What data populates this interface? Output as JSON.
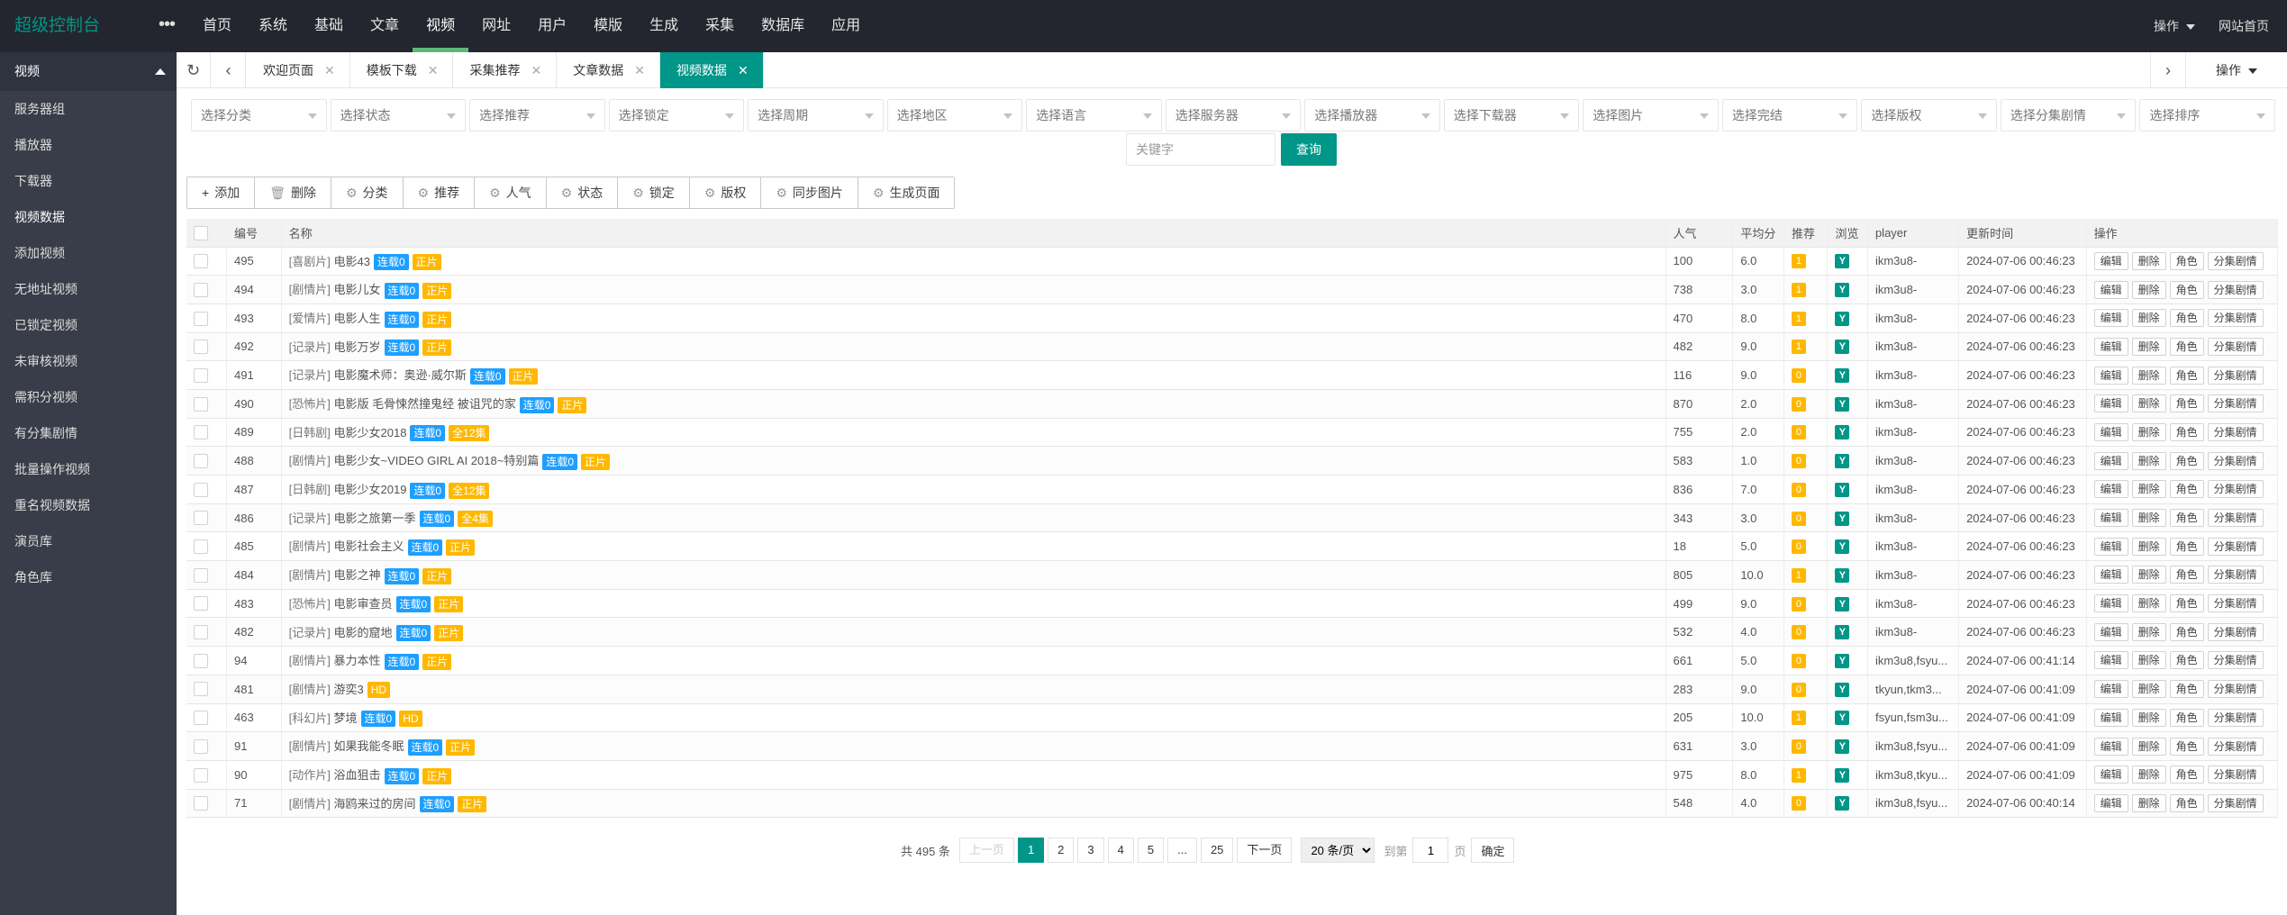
{
  "header": {
    "logo": "超级控制台",
    "nav": [
      "首页",
      "系统",
      "基础",
      "文章",
      "视频",
      "网址",
      "用户",
      "模版",
      "生成",
      "采集",
      "数据库",
      "应用"
    ],
    "active_nav": "视频",
    "ops": "操作",
    "site_home": "网站首页"
  },
  "sidebar": {
    "section": "视频",
    "items": [
      "服务器组",
      "播放器",
      "下载器",
      "视频数据",
      "添加视频",
      "无地址视频",
      "已锁定视频",
      "未审核视频",
      "需积分视频",
      "有分集剧情",
      "批量操作视频",
      "重名视频数据",
      "演员库",
      "角色库"
    ],
    "active": "视频数据"
  },
  "tabs": {
    "items": [
      "欢迎页面",
      "模板下载",
      "采集推荐",
      "文章数据",
      "视频数据"
    ],
    "active": "视频数据",
    "ops": "操作"
  },
  "filters": {
    "selects": [
      "选择分类",
      "选择状态",
      "选择推荐",
      "选择锁定",
      "选择周期",
      "选择地区",
      "选择语言",
      "选择服务器",
      "选择播放器",
      "选择下载器",
      "选择图片",
      "选择完结",
      "选择版权",
      "选择分集剧情",
      "选择排序"
    ],
    "keyword_placeholder": "关键字",
    "query": "查询"
  },
  "actions": [
    "添加",
    "删除",
    "分类",
    "推荐",
    "人气",
    "状态",
    "锁定",
    "版权",
    "同步图片",
    "生成页面"
  ],
  "table": {
    "headers": [
      "编号",
      "名称",
      "人气",
      "平均分",
      "推荐",
      "浏览",
      "player",
      "更新时间",
      "操作"
    ],
    "row_ops": [
      "编辑",
      "删除",
      "角色",
      "分集剧情"
    ],
    "rows": [
      {
        "id": "495",
        "type": "[喜剧片]",
        "name": "电影43",
        "b1": "连载0",
        "b2": "正片",
        "hits": "100",
        "score": "6.0",
        "rec": "1",
        "view": "Y",
        "player": "ikm3u8-",
        "time": "2024-07-06 00:46:23"
      },
      {
        "id": "494",
        "type": "[剧情片]",
        "name": "电影儿女",
        "b1": "连载0",
        "b2": "正片",
        "hits": "738",
        "score": "3.0",
        "rec": "1",
        "view": "Y",
        "player": "ikm3u8-",
        "time": "2024-07-06 00:46:23"
      },
      {
        "id": "493",
        "type": "[爱情片]",
        "name": "电影人生",
        "b1": "连载0",
        "b2": "正片",
        "hits": "470",
        "score": "8.0",
        "rec": "1",
        "view": "Y",
        "player": "ikm3u8-",
        "time": "2024-07-06 00:46:23"
      },
      {
        "id": "492",
        "type": "[记录片]",
        "name": "电影万岁",
        "b1": "连载0",
        "b2": "正片",
        "hits": "482",
        "score": "9.0",
        "rec": "1",
        "view": "Y",
        "player": "ikm3u8-",
        "time": "2024-07-06 00:46:23"
      },
      {
        "id": "491",
        "type": "[记录片]",
        "name": "电影魔术师：奥逊·威尔斯",
        "b1": "连载0",
        "b2": "正片",
        "hits": "116",
        "score": "9.0",
        "rec": "0",
        "view": "Y",
        "player": "ikm3u8-",
        "time": "2024-07-06 00:46:23"
      },
      {
        "id": "490",
        "type": "[恐怖片]",
        "name": "电影版 毛骨悚然撞鬼经 被诅咒的家",
        "b1": "连载0",
        "b2": "正片",
        "hits": "870",
        "score": "2.0",
        "rec": "0",
        "view": "Y",
        "player": "ikm3u8-",
        "time": "2024-07-06 00:46:23"
      },
      {
        "id": "489",
        "type": "[日韩剧]",
        "name": "电影少女2018",
        "b1": "连载0",
        "b2": "全12集",
        "hits": "755",
        "score": "2.0",
        "rec": "0",
        "view": "Y",
        "player": "ikm3u8-",
        "time": "2024-07-06 00:46:23"
      },
      {
        "id": "488",
        "type": "[剧情片]",
        "name": "电影少女~VIDEO GIRL AI 2018~特别篇",
        "b1": "连载0",
        "b2": "正片",
        "hits": "583",
        "score": "1.0",
        "rec": "0",
        "view": "Y",
        "player": "ikm3u8-",
        "time": "2024-07-06 00:46:23"
      },
      {
        "id": "487",
        "type": "[日韩剧]",
        "name": "电影少女2019",
        "b1": "连载0",
        "b2": "全12集",
        "hits": "836",
        "score": "7.0",
        "rec": "0",
        "view": "Y",
        "player": "ikm3u8-",
        "time": "2024-07-06 00:46:23"
      },
      {
        "id": "486",
        "type": "[记录片]",
        "name": "电影之旅第一季",
        "b1": "连载0",
        "b2": "全4集",
        "hits": "343",
        "score": "3.0",
        "rec": "0",
        "view": "Y",
        "player": "ikm3u8-",
        "time": "2024-07-06 00:46:23"
      },
      {
        "id": "485",
        "type": "[剧情片]",
        "name": "电影社会主义",
        "b1": "连载0",
        "b2": "正片",
        "hits": "18",
        "score": "5.0",
        "rec": "0",
        "view": "Y",
        "player": "ikm3u8-",
        "time": "2024-07-06 00:46:23"
      },
      {
        "id": "484",
        "type": "[剧情片]",
        "name": "电影之神",
        "b1": "连载0",
        "b2": "正片",
        "hits": "805",
        "score": "10.0",
        "rec": "1",
        "view": "Y",
        "player": "ikm3u8-",
        "time": "2024-07-06 00:46:23"
      },
      {
        "id": "483",
        "type": "[恐怖片]",
        "name": "电影审查员",
        "b1": "连载0",
        "b2": "正片",
        "hits": "499",
        "score": "9.0",
        "rec": "0",
        "view": "Y",
        "player": "ikm3u8-",
        "time": "2024-07-06 00:46:23"
      },
      {
        "id": "482",
        "type": "[记录片]",
        "name": "电影的窟地",
        "b1": "连载0",
        "b2": "正片",
        "hits": "532",
        "score": "4.0",
        "rec": "0",
        "view": "Y",
        "player": "ikm3u8-",
        "time": "2024-07-06 00:46:23"
      },
      {
        "id": "94",
        "type": "[剧情片]",
        "name": "暴力本性",
        "b1": "连载0",
        "b2": "正片",
        "hits": "661",
        "score": "5.0",
        "rec": "0",
        "view": "Y",
        "player": "ikm3u8,fsyu...",
        "time": "2024-07-06 00:41:14"
      },
      {
        "id": "481",
        "type": "[剧情片]",
        "name": "游奕3",
        "b1": "",
        "b2": "HD",
        "hits": "283",
        "score": "9.0",
        "rec": "0",
        "view": "Y",
        "player": "tkyun,tkm3...",
        "time": "2024-07-06 00:41:09"
      },
      {
        "id": "463",
        "type": "[科幻片]",
        "name": "梦境",
        "b1": "连载0",
        "b2": "HD",
        "hits": "205",
        "score": "10.0",
        "rec": "1",
        "view": "Y",
        "player": "fsyun,fsm3u...",
        "time": "2024-07-06 00:41:09"
      },
      {
        "id": "91",
        "type": "[剧情片]",
        "name": "如果我能冬眠",
        "b1": "连载0",
        "b2": "正片",
        "hits": "631",
        "score": "3.0",
        "rec": "0",
        "view": "Y",
        "player": "ikm3u8,fsyu...",
        "time": "2024-07-06 00:41:09"
      },
      {
        "id": "90",
        "type": "[动作片]",
        "name": "浴血狙击",
        "b1": "连载0",
        "b2": "正片",
        "hits": "975",
        "score": "8.0",
        "rec": "1",
        "view": "Y",
        "player": "ikm3u8,tkyu...",
        "time": "2024-07-06 00:41:09"
      },
      {
        "id": "71",
        "type": "[剧情片]",
        "name": "海鸥来过的房间",
        "b1": "连载0",
        "b2": "正片",
        "hits": "548",
        "score": "4.0",
        "rec": "0",
        "view": "Y",
        "player": "ikm3u8,fsyu...",
        "time": "2024-07-06 00:40:14"
      }
    ]
  },
  "pager": {
    "total": "共 495 条",
    "prev": "上一页",
    "pages": [
      "1",
      "2",
      "3",
      "4",
      "5",
      "...",
      "25"
    ],
    "active": "1",
    "next": "下一页",
    "size": "20 条/页",
    "goto": "到第",
    "goto_value": "1",
    "page_unit": "页",
    "ok": "确定"
  },
  "colors": {
    "header_bg": "#23262e",
    "sidebar_bg": "#393d49",
    "accent": "#009688",
    "badge_blue": "#1e9fff",
    "badge_orange": "#ffb800",
    "time_red": "#ff2d2d"
  }
}
